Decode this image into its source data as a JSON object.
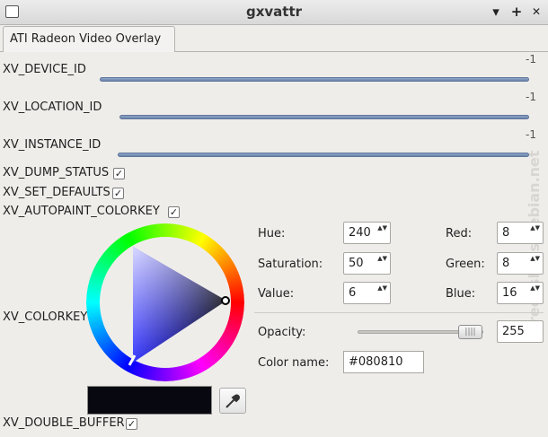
{
  "window": {
    "title": "gxvattr",
    "minimize": "▾",
    "maximize": "+",
    "close": "✕"
  },
  "tab": {
    "label": "ATI Radeon Video Overlay"
  },
  "attributes": {
    "device_id": {
      "label": "XV_DEVICE_ID",
      "value": "-1"
    },
    "location_id": {
      "label": "XV_LOCATION_ID",
      "value": "-1"
    },
    "instance_id": {
      "label": "XV_INSTANCE_ID",
      "value": "-1"
    },
    "dump_status": {
      "label": "XV_DUMP_STATUS",
      "checked": true
    },
    "set_defaults": {
      "label": "XV_SET_DEFAULTS",
      "checked": true
    },
    "autopaint": {
      "label": "XV_AUTOPAINT_COLORKEY",
      "checked": true
    },
    "colorkey": {
      "label": "XV_COLORKEY"
    },
    "double_buffer": {
      "label": "XV_DOUBLE_BUFFER",
      "checked": true
    }
  },
  "color_editor": {
    "hue_label": "Hue:",
    "hue": "240",
    "saturation_label": "Saturation:",
    "saturation": "50",
    "value_label": "Value:",
    "value": "6",
    "red_label": "Red:",
    "red": "8",
    "green_label": "Green:",
    "green": "8",
    "blue_label": "Blue:",
    "blue": "16",
    "opacity_label": "Opacity:",
    "opacity": "255",
    "opacity_level": 1.0,
    "color_name_label": "Color name:",
    "color_name": "#080810",
    "current_color": "#080810"
  },
  "watermark": "screenshots.debian.net",
  "check_glyph": "✓",
  "spin_glyph": "▲▼"
}
